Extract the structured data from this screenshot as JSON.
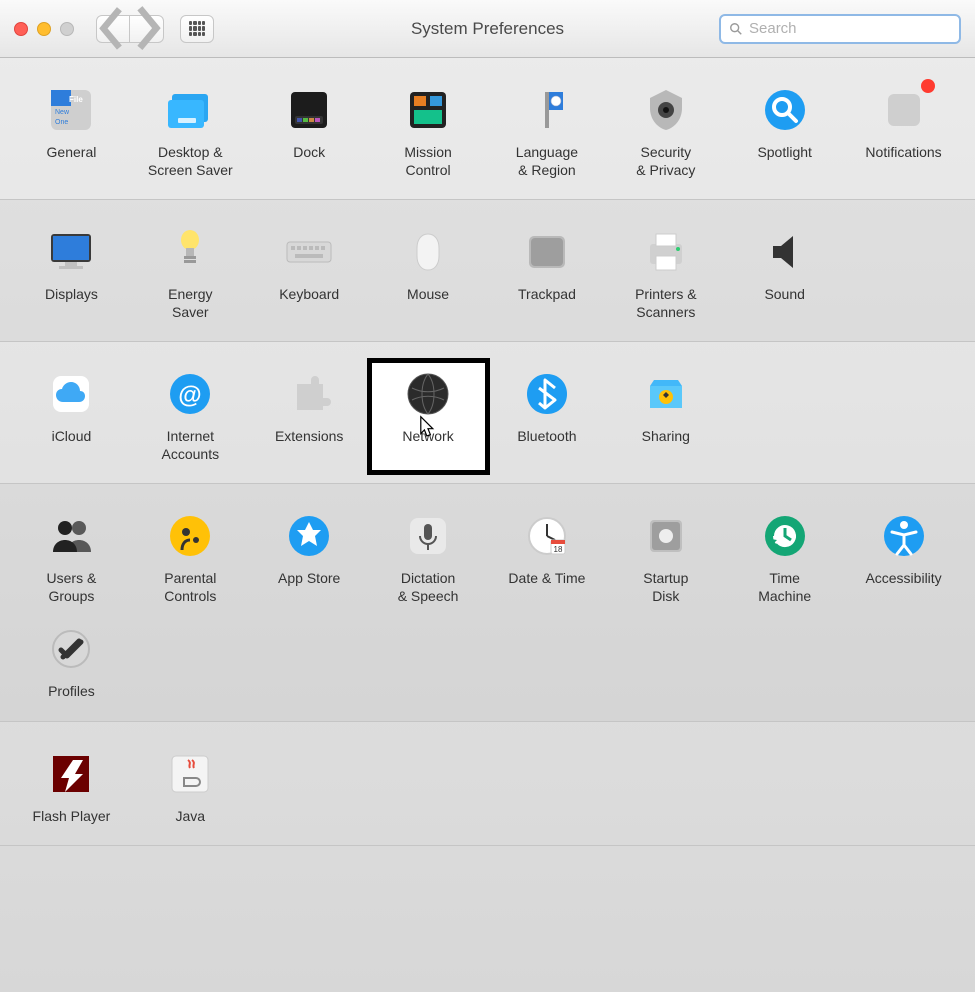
{
  "window": {
    "title": "System Preferences"
  },
  "search": {
    "placeholder": "Search"
  },
  "sections": [
    {
      "style": "light",
      "items": [
        {
          "id": "general",
          "label": "General"
        },
        {
          "id": "desktop",
          "label": "Desktop &\nScreen Saver"
        },
        {
          "id": "dock",
          "label": "Dock"
        },
        {
          "id": "mission",
          "label": "Mission\nControl"
        },
        {
          "id": "language",
          "label": "Language\n& Region"
        },
        {
          "id": "security",
          "label": "Security\n& Privacy"
        },
        {
          "id": "spotlight",
          "label": "Spotlight"
        },
        {
          "id": "notifications",
          "label": "Notifications",
          "badge": true
        }
      ]
    },
    {
      "style": "dark",
      "items": [
        {
          "id": "displays",
          "label": "Displays"
        },
        {
          "id": "energy",
          "label": "Energy\nSaver"
        },
        {
          "id": "keyboard",
          "label": "Keyboard"
        },
        {
          "id": "mouse",
          "label": "Mouse"
        },
        {
          "id": "trackpad",
          "label": "Trackpad"
        },
        {
          "id": "printers",
          "label": "Printers &\nScanners"
        },
        {
          "id": "sound",
          "label": "Sound"
        }
      ]
    },
    {
      "style": "light",
      "items": [
        {
          "id": "icloud",
          "label": "iCloud"
        },
        {
          "id": "internet",
          "label": "Internet\nAccounts"
        },
        {
          "id": "extensions",
          "label": "Extensions"
        },
        {
          "id": "network",
          "label": "Network",
          "highlight": true,
          "cursor": true
        },
        {
          "id": "bluetooth",
          "label": "Bluetooth"
        },
        {
          "id": "sharing",
          "label": "Sharing"
        }
      ]
    },
    {
      "style": "dark",
      "items": [
        {
          "id": "users",
          "label": "Users &\nGroups"
        },
        {
          "id": "parental",
          "label": "Parental\nControls"
        },
        {
          "id": "appstore",
          "label": "App Store"
        },
        {
          "id": "dictation",
          "label": "Dictation\n& Speech"
        },
        {
          "id": "datetime",
          "label": "Date & Time"
        },
        {
          "id": "startup",
          "label": "Startup\nDisk"
        },
        {
          "id": "timemachine",
          "label": "Time\nMachine"
        },
        {
          "id": "accessibility",
          "label": "Accessibility"
        },
        {
          "id": "profiles",
          "label": "Profiles"
        }
      ]
    },
    {
      "style": "light",
      "items": [
        {
          "id": "flash",
          "label": "Flash Player"
        },
        {
          "id": "java",
          "label": "Java"
        }
      ]
    }
  ]
}
